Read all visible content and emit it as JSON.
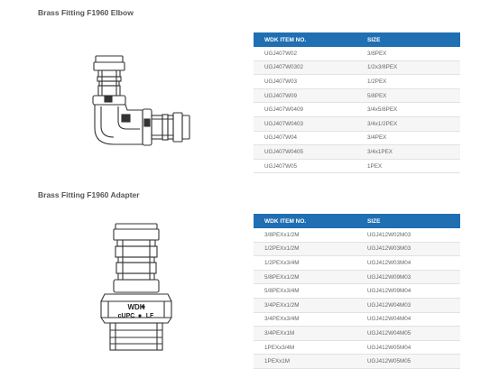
{
  "section1": {
    "title": "Brass Fitting F1960 Elbow",
    "headers": [
      "WDK ITEM NO.",
      "SIZE"
    ],
    "rows": [
      [
        "UGJ407W02",
        "3/8PEX"
      ],
      [
        "UGJ407W0302",
        "1/2x3/8PEX"
      ],
      [
        "UGJ407W03",
        "1/2PEX"
      ],
      [
        "UGJ407W09",
        "5/8PEX"
      ],
      [
        "UGJ407W0409",
        "3/4x5/8PEX"
      ],
      [
        "UGJ407W0403",
        "3/4x1/2PEX"
      ],
      [
        "UGJ407W04",
        "3/4PEX"
      ],
      [
        "UGJ407W0405",
        "3/4x1PEX"
      ],
      [
        "UGJ407W05",
        "1PEX"
      ]
    ]
  },
  "section2": {
    "title": "Brass Fitting F1960 Adapter",
    "headers": [
      "WDK ITEM NO.",
      "SIZE"
    ],
    "rows": [
      [
        "3/8PEXx1/2M",
        "UGJ412W02M03"
      ],
      [
        "1/2PEXx1/2M",
        "UGJ412W03M03"
      ],
      [
        "1/2PEXx3/4M",
        "UGJ412W03M04"
      ],
      [
        "5/8PEXx1/2M",
        "UGJ412W09M03"
      ],
      [
        "5/8PEXx3/4M",
        "UGJ412W09M04"
      ],
      [
        "3/4PEXx1/2M",
        "UGJ412W04M03"
      ],
      [
        "3/4PEXx3/4M",
        "UGJ412W04M04"
      ],
      [
        "3/4PEXx1M",
        "UGJ412W04M05"
      ],
      [
        "1PEXx3/4M",
        "UGJ412W05M04"
      ],
      [
        "1PEXx1M",
        "UGJ412W05M05"
      ]
    ],
    "fitting_marking": [
      "WDK",
      "cUPC",
      "LF"
    ]
  },
  "colors": {
    "header_bg": "#1f6fb2",
    "row_alt": "#f6f6f6",
    "line": "#333333"
  }
}
